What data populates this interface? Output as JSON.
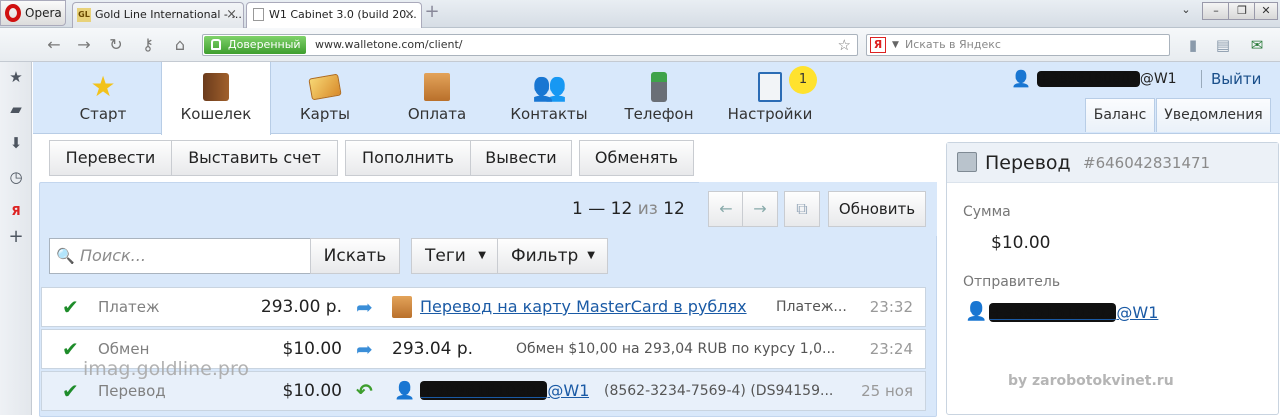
{
  "browser": {
    "menu_label": "Opera",
    "tabs": [
      {
        "favicon": "GL",
        "label": "Gold Line International - ..."
      },
      {
        "favicon": "doc",
        "label": "W1 Cabinet 3.0 (build 20..."
      }
    ],
    "trusted_label": "Доверенный",
    "url": "www.walletone.com/client/",
    "search_placeholder": "Искать в Яндекс",
    "search_engine_icon": "Я"
  },
  "nav": {
    "items": [
      {
        "label": "Старт",
        "icon": "star-icon"
      },
      {
        "label": "Кошелек",
        "icon": "wallet-icon",
        "active": true
      },
      {
        "label": "Карты",
        "icon": "cards-icon"
      },
      {
        "label": "Оплата",
        "icon": "payment-icon"
      },
      {
        "label": "Контакты",
        "icon": "contacts-icon"
      },
      {
        "label": "Телефон",
        "icon": "phone-icon"
      },
      {
        "label": "Настройки",
        "icon": "settings-icon"
      }
    ],
    "settings_badge": "1",
    "user_suffix": "@W1",
    "logout": "Выйти",
    "right_tabs": [
      "Баланс",
      "Уведомления"
    ]
  },
  "toolbar": {
    "transfer": "Перевести",
    "invoice": "Выставить счет",
    "topup": "Пополнить",
    "withdraw": "Вывести",
    "exchange": "Обменять"
  },
  "pager": {
    "from": "1",
    "dash": "—",
    "to": "12",
    "of": "из",
    "total": "12",
    "prev": "←",
    "next": "→",
    "refresh": "Обновить"
  },
  "filters": {
    "search_placeholder": "Поиск...",
    "search_button": "Искать",
    "tags": "Теги",
    "filter": "Фильтр"
  },
  "transactions": [
    {
      "type": "Платеж",
      "amount": "293.00 р.",
      "target": "Перевод на карту MasterCard в рублях",
      "detail": "Платеж...",
      "time": "23:32"
    },
    {
      "type": "Обмен",
      "amount": "$10.00",
      "target": "293.04 р.",
      "detail": "Обмен $10,00 на 293,04 RUB по курсу 1,0...",
      "time": "23:24"
    },
    {
      "type": "Перевод",
      "amount": "$10.00",
      "target_suffix": "@W1",
      "detail": "(8562-3234-7569-4) (DS94159...",
      "time": "25 ноя"
    }
  ],
  "details": {
    "title": "Перевод",
    "id": "#646042831471",
    "sum_label": "Сумма",
    "sum_value": "$10.00",
    "sender_label": "Отправитель",
    "sender_suffix": "@W1"
  },
  "watermarks": {
    "left": "imag.goldline.pro",
    "right": "by zarobotokvinet.ru"
  },
  "colors": {
    "nav_bg": "#d8e8fb",
    "link": "#1a5aa5",
    "check": "#1e8c2a",
    "badge": "#ffe22e",
    "trusted": "#3e9e2e"
  }
}
